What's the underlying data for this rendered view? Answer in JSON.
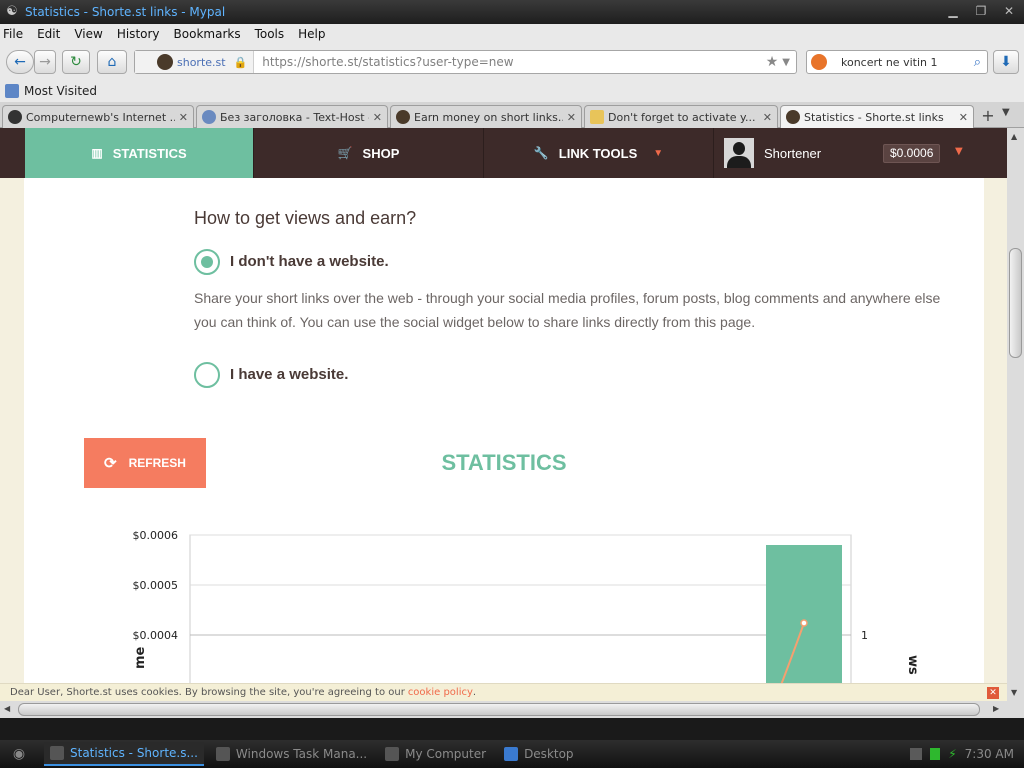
{
  "window": {
    "title": "Statistics - Shorte.st links - Mypal"
  },
  "menu": [
    "File",
    "Edit",
    "View",
    "History",
    "Bookmarks",
    "Tools",
    "Help"
  ],
  "urlbar": {
    "domain": "shorte.st",
    "url": "https://shorte.st/statistics?user-type=new"
  },
  "search": {
    "value": "koncert ne vitin 1"
  },
  "bookmarks": {
    "most_visited": "Most Visited"
  },
  "tabs": [
    {
      "label": "Computernewb's Internet ..."
    },
    {
      "label": "Без заголовка - Text-Host -..."
    },
    {
      "label": "Earn money on short links..."
    },
    {
      "label": "Don't forget to activate y..."
    },
    {
      "label": "Statistics - Shorte.st links"
    }
  ],
  "site_nav": {
    "statistics": "STATISTICS",
    "shop": "SHOP",
    "link_tools": "LINK TOOLS",
    "user": "Shortener",
    "balance": "$0.0006"
  },
  "earn": {
    "heading": "How to get views and earn?",
    "no_site_label": "I don't have a website.",
    "no_site_text": "Share your short links over the web - through your social media profiles, forum posts, blog comments and anywhere else you can think of. You can use the social widget below to share links directly from this page.",
    "have_site_label": "I have a website.",
    "selected": "no_website"
  },
  "stats": {
    "refresh": "REFRESH",
    "title": "STATISTICS"
  },
  "chart_data": {
    "type": "bar",
    "series": [
      {
        "values": [
          0.00058
        ]
      },
      {
        "values": [
          1
        ]
      }
    ],
    "y_ticks": [
      "$0.0006",
      "$0.0005",
      "$0.0004"
    ],
    "y_right_ticks": [
      "1"
    ],
    "ylabel": "me",
    "ylabel_right": "ws",
    "ylim": [
      0.0003,
      0.0006
    ],
    "y_right_lim": [
      0,
      1
    ],
    "bar_color": "#6ebfa0",
    "line_color": "#f5a070"
  },
  "cookie": {
    "text": "Dear User, Shorte.st uses cookies. By browsing the site, you're agreeing to our",
    "link": "cookie policy",
    "end": "."
  },
  "taskbar": {
    "items": [
      "Statistics - Shorte.s...",
      "Windows Task Mana...",
      "My Computer",
      "Desktop"
    ],
    "clock": "7:30 AM"
  },
  "colors": {
    "accent": "#6ebfa0",
    "nav_bg": "#3d2a29",
    "refresh": "#f57c60"
  }
}
